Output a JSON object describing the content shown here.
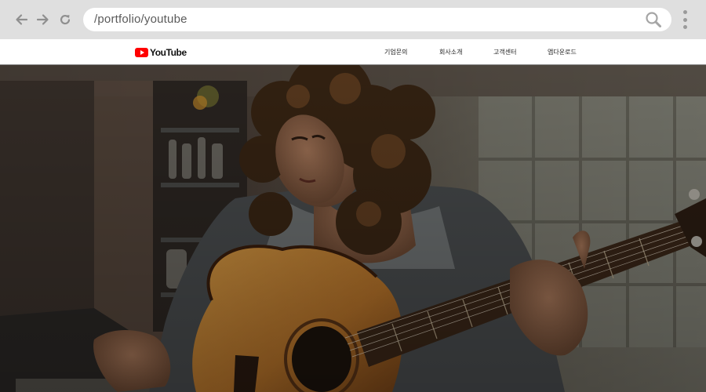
{
  "browser": {
    "address": "/portfolio/youtube",
    "icons": [
      "arrow-left-icon",
      "arrow-right-icon",
      "reload-icon",
      "search-icon",
      "kebab-menu-icon"
    ]
  },
  "header": {
    "logo_text": "YouTube",
    "menu": [
      {
        "label": "기업문의"
      },
      {
        "label": "회사소개"
      },
      {
        "label": "고객센터"
      },
      {
        "label": "앱다운로드"
      }
    ]
  },
  "hero": {
    "image": "woman-playing-acoustic-guitar-photo"
  },
  "colors": {
    "chrome": "#dfdfdf",
    "brand_red": "#ff0000",
    "header_bg": "#ffffff"
  }
}
